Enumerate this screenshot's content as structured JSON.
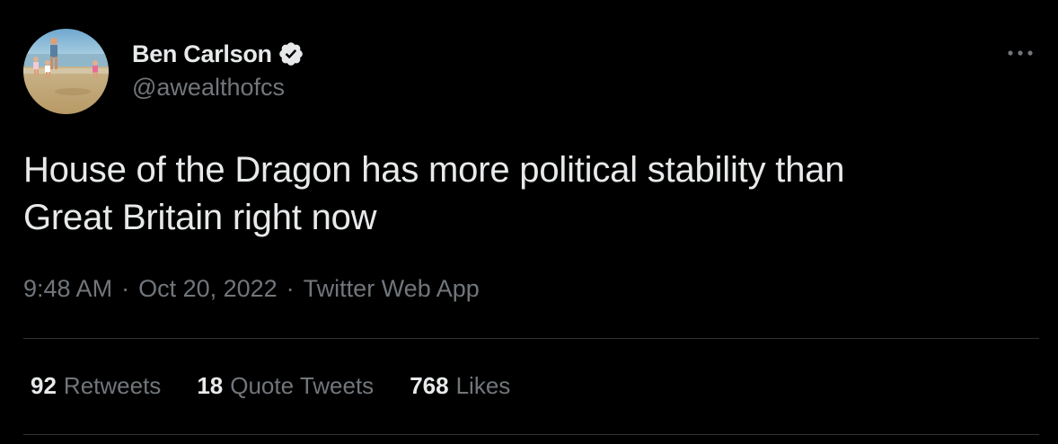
{
  "author": {
    "display_name": "Ben Carlson",
    "handle": "@awealthofcs",
    "verified": true,
    "avatar_icon": "beach-family-photo"
  },
  "tweet": {
    "text_line1": "House of the Dragon has more political stability than",
    "text_line2": "Great Britain right now",
    "time": "9:48 AM",
    "date": "Oct 20, 2022",
    "separator": "·",
    "source": "Twitter Web App"
  },
  "stats": {
    "retweets_count": "92",
    "retweets_label": "Retweets",
    "quotes_count": "18",
    "quotes_label": "Quote Tweets",
    "likes_count": "768",
    "likes_label": "Likes"
  },
  "icons": {
    "more": "more-horizontal-icon",
    "verified": "verified-badge-icon"
  },
  "colors": {
    "background": "#000000",
    "primary_text": "#e7e9ea",
    "secondary_text": "#71767b",
    "divider": "#2f3336"
  }
}
